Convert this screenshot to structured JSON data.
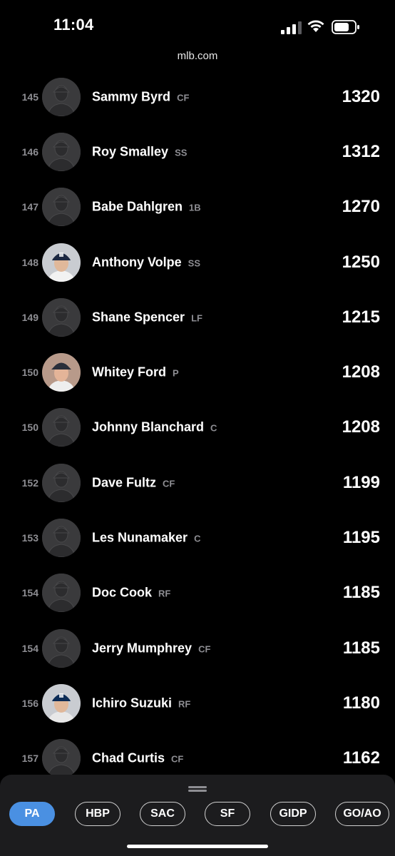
{
  "status": {
    "time": "11:04",
    "icons": [
      "cellular-signal-icon",
      "wifi-icon",
      "battery-icon"
    ]
  },
  "browser": {
    "url": "mlb.com"
  },
  "leaderboard": {
    "rows": [
      {
        "rank": "145",
        "name": "Sammy Byrd",
        "pos": "CF",
        "value": "1320",
        "avatar": "silhouette"
      },
      {
        "rank": "146",
        "name": "Roy Smalley",
        "pos": "SS",
        "value": "1312",
        "avatar": "silhouette"
      },
      {
        "rank": "147",
        "name": "Babe Dahlgren",
        "pos": "1B",
        "value": "1270",
        "avatar": "silhouette"
      },
      {
        "rank": "148",
        "name": "Anthony Volpe",
        "pos": "SS",
        "value": "1250",
        "avatar": "photo-yankees-cap"
      },
      {
        "rank": "149",
        "name": "Shane Spencer",
        "pos": "LF",
        "value": "1215",
        "avatar": "silhouette"
      },
      {
        "rank": "150",
        "name": "Whitey Ford",
        "pos": "P",
        "value": "1208",
        "avatar": "photo-vintage"
      },
      {
        "rank": "150",
        "name": "Johnny Blanchard",
        "pos": "C",
        "value": "1208",
        "avatar": "silhouette"
      },
      {
        "rank": "152",
        "name": "Dave Fultz",
        "pos": "CF",
        "value": "1199",
        "avatar": "silhouette"
      },
      {
        "rank": "153",
        "name": "Les Nunamaker",
        "pos": "C",
        "value": "1195",
        "avatar": "silhouette"
      },
      {
        "rank": "154",
        "name": "Doc Cook",
        "pos": "RF",
        "value": "1185",
        "avatar": "silhouette"
      },
      {
        "rank": "154",
        "name": "Jerry Mumphrey",
        "pos": "CF",
        "value": "1185",
        "avatar": "silhouette"
      },
      {
        "rank": "156",
        "name": "Ichiro Suzuki",
        "pos": "RF",
        "value": "1180",
        "avatar": "photo-mariners-cap"
      },
      {
        "rank": "157",
        "name": "Chad Curtis",
        "pos": "CF",
        "value": "1162",
        "avatar": "silhouette"
      }
    ]
  },
  "stat_tabs": {
    "active": "PA",
    "items": [
      "PA",
      "HBP",
      "SAC",
      "SF",
      "GIDP",
      "GO/AO"
    ]
  },
  "colors": {
    "background": "#000000",
    "sheet": "#1c1c1e",
    "active_tab": "#4a90e2",
    "secondary_text": "#8e8e93"
  }
}
